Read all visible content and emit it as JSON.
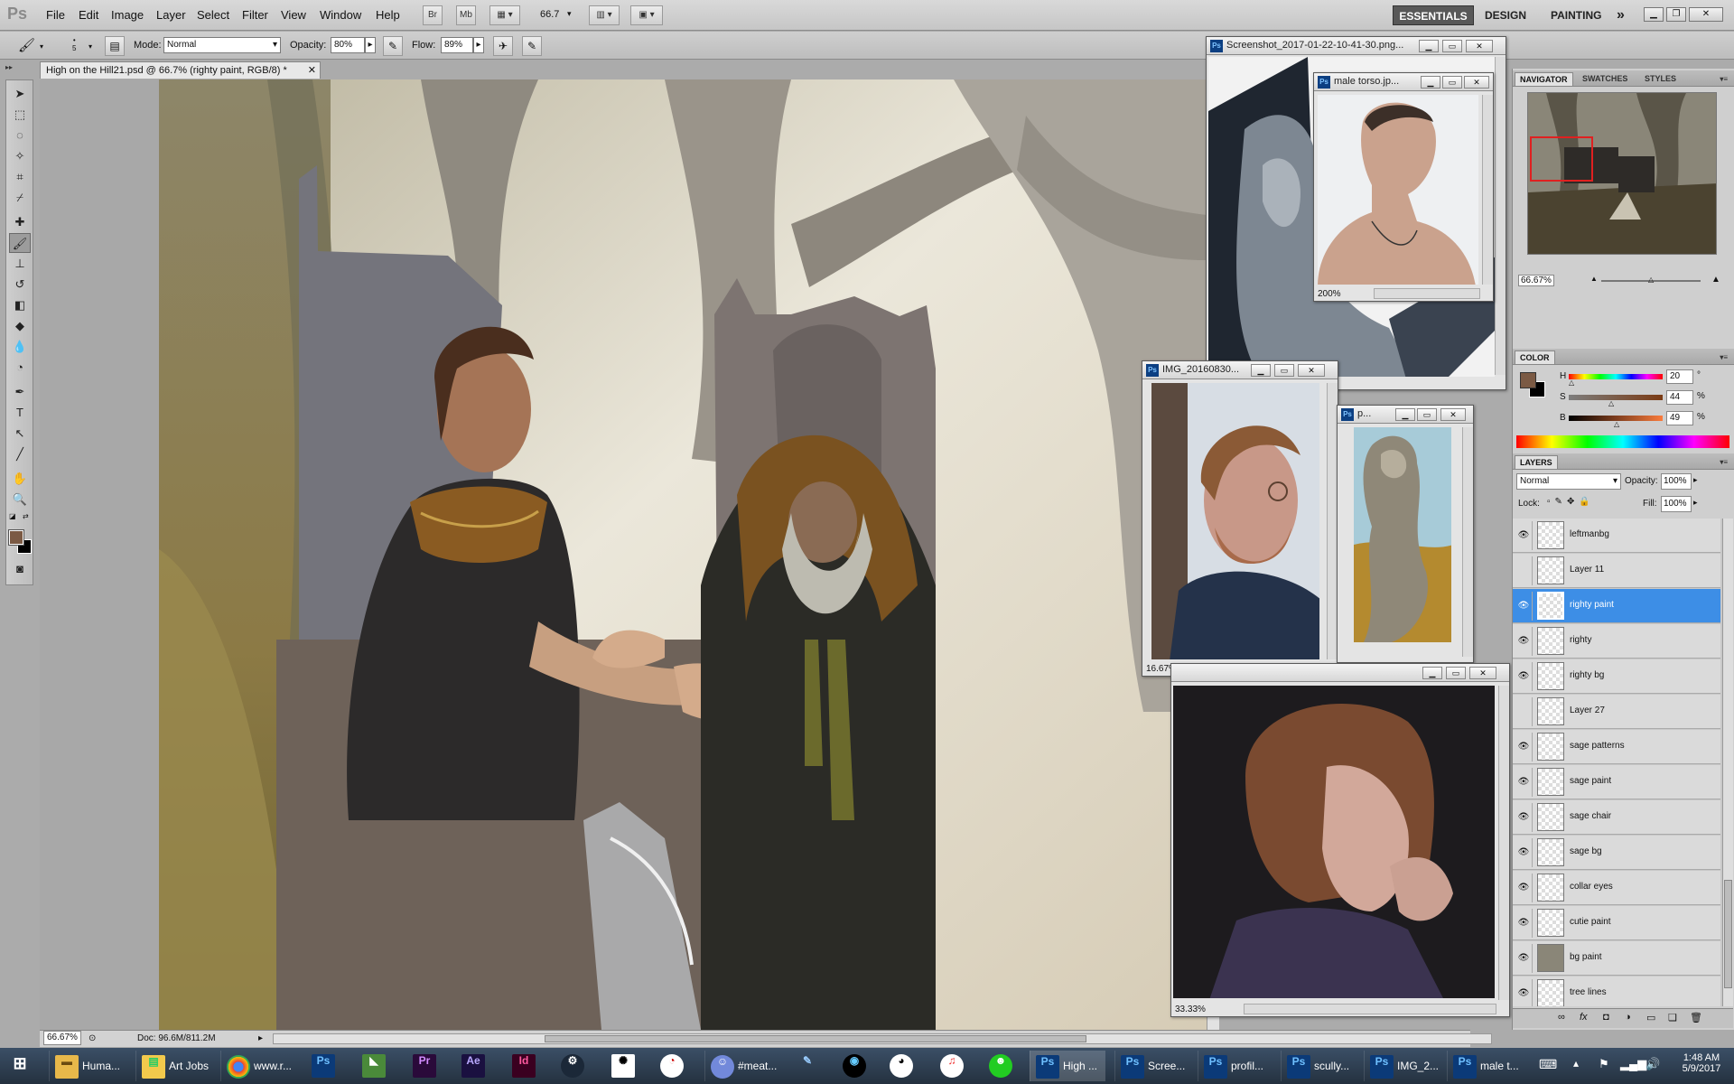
{
  "menubar": {
    "logo": "Ps",
    "menus": [
      "File",
      "Edit",
      "Image",
      "Layer",
      "Select",
      "Filter",
      "View",
      "Window",
      "Help"
    ],
    "bridge_btn": "Br",
    "minibridge_btn": "Mb",
    "zoom": "66.7",
    "workspaces": [
      "ESSENTIALS",
      "DESIGN",
      "PAINTING"
    ],
    "more": "»"
  },
  "options": {
    "brush_size": "5",
    "mode_label": "Mode:",
    "mode_value": "Normal",
    "opacity_label": "Opacity:",
    "opacity_value": "80%",
    "flow_label": "Flow:",
    "flow_value": "89%"
  },
  "document": {
    "tab_title": "High on the Hill21.psd @ 66.7% (righty paint, RGB/8) *",
    "zoom": "66.67%",
    "doc_size": "Doc: 96.6M/811.2M"
  },
  "ref_windows": [
    {
      "title": "Screenshot_2017-01-22-10-41-30.png..."
    },
    {
      "title": "male torso.jp...",
      "zoom": "200%"
    },
    {
      "title": "IMG_20160830...",
      "zoom": "16.67%"
    },
    {
      "title": "p..."
    },
    {
      "title": "",
      "zoom": "33.33%"
    }
  ],
  "navigator": {
    "tabs": [
      "NAVIGATOR",
      "SWATCHES",
      "STYLES"
    ],
    "zoom": "66.67%"
  },
  "color": {
    "tab": "COLOR",
    "h_label": "H",
    "h_value": "20",
    "h_unit": "°",
    "s_label": "S",
    "s_value": "44",
    "s_unit": "%",
    "b_label": "B",
    "b_value": "49",
    "b_unit": "%",
    "fg": "#7b5a44",
    "bg": "#000000"
  },
  "layers": {
    "tab": "LAYERS",
    "blend": "Normal",
    "opacity_label": "Opacity:",
    "opacity_value": "100%",
    "lock_label": "Lock:",
    "fill_label": "Fill:",
    "fill_value": "100%",
    "items": [
      {
        "name": "leftmanbg",
        "visible": true
      },
      {
        "name": "Layer 11",
        "visible": false
      },
      {
        "name": "righty paint",
        "visible": true,
        "selected": true
      },
      {
        "name": "righty",
        "visible": true
      },
      {
        "name": "righty bg",
        "visible": true
      },
      {
        "name": "Layer 27",
        "visible": false
      },
      {
        "name": "sage patterns",
        "visible": true
      },
      {
        "name": "sage paint",
        "visible": true
      },
      {
        "name": "sage chair",
        "visible": true
      },
      {
        "name": "sage bg",
        "visible": true
      },
      {
        "name": "collar eyes",
        "visible": true
      },
      {
        "name": "cutie paint",
        "visible": true
      },
      {
        "name": "bg paint",
        "visible": true
      },
      {
        "name": "tree lines",
        "visible": true
      }
    ]
  },
  "taskbar": {
    "tasks": [
      {
        "label": "Huma...",
        "icon": "folder-icon"
      },
      {
        "label": "Art Jobs",
        "icon": "notes-icon"
      },
      {
        "label": "www.r...",
        "icon": "chrome-icon"
      },
      {
        "label": "#meat...",
        "icon": "discord-icon"
      },
      {
        "label": "High ...",
        "icon": "photoshop-icon"
      },
      {
        "label": "Scree...",
        "icon": "photoshop-icon"
      },
      {
        "label": "profil...",
        "icon": "photoshop-icon"
      },
      {
        "label": "scully...",
        "icon": "photoshop-icon"
      },
      {
        "label": "IMG_2...",
        "icon": "photoshop-icon"
      },
      {
        "label": "male t...",
        "icon": "photoshop-icon"
      }
    ],
    "time": "1:48 AM",
    "date": "5/9/2017"
  }
}
